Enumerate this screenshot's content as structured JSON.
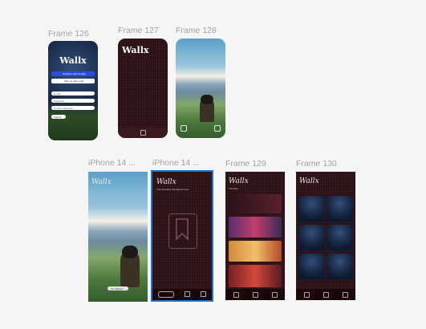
{
  "frames": {
    "f126": {
      "label": "Frame 126",
      "title": "Wallx",
      "primary_btn": "Continue with Google",
      "secondary_btn": "Sign up with email",
      "fields": [
        "E-mail",
        "Password",
        "Confirm password"
      ],
      "submit": "Submit"
    },
    "f127": {
      "label": "Frame 127",
      "title": "Wallx"
    },
    "f128": {
      "label": "Frame 128"
    },
    "iphone_a": {
      "label": "iPhone 14 ...",
      "title": "Wallx",
      "pill": "Get Started"
    },
    "iphone_b": {
      "label": "iPhone 14 ...",
      "title": "Wallx",
      "subtitle": "Your favorites will appear here"
    },
    "f129": {
      "label": "Frame 129",
      "title": "Wallx",
      "subtitle": "Trending"
    },
    "f130": {
      "label": "Frame 130",
      "title": "Wallx"
    }
  },
  "colors": {
    "accent": "#1d74d8",
    "dark_frame": "#2b0f12",
    "blue_button": "#2d4de0"
  }
}
